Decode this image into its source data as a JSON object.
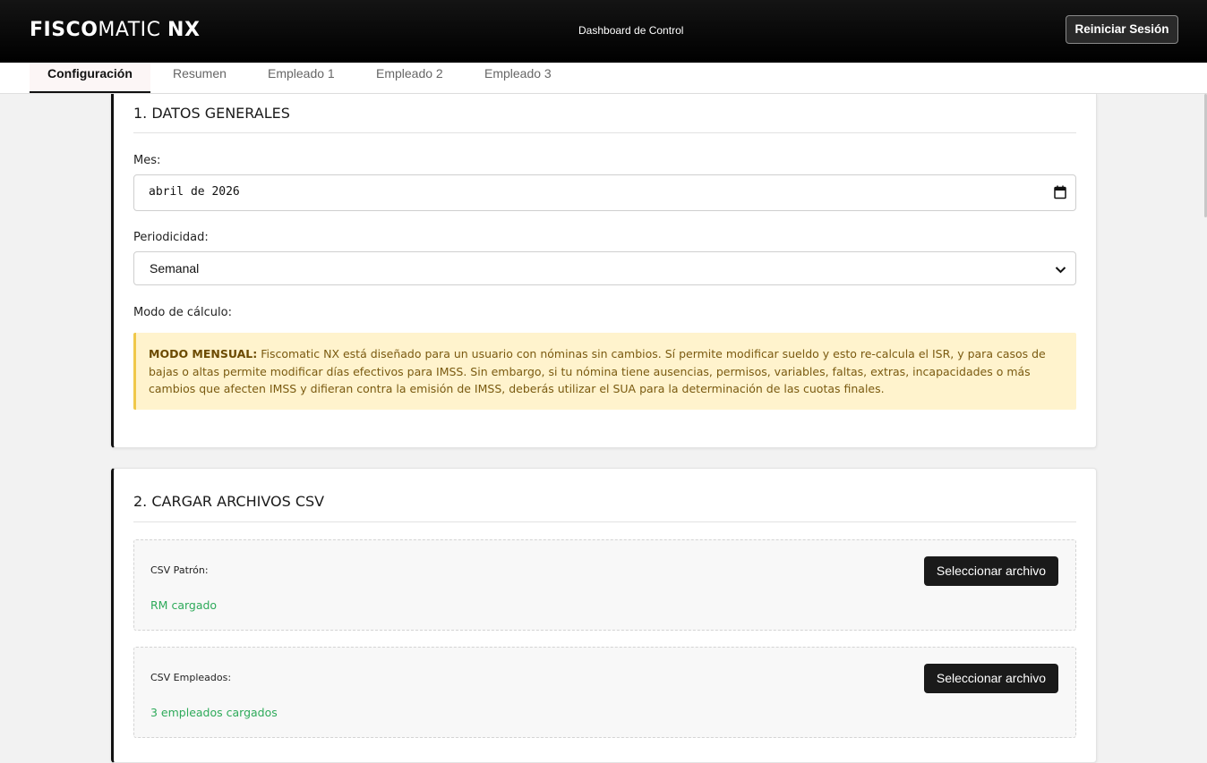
{
  "header": {
    "brand_part1": "FISCO",
    "brand_part2": "MATIC",
    "brand_part3": "NX",
    "center_title": "Dashboard de Control",
    "reset_label": "Reiniciar Sesión"
  },
  "tabs": [
    {
      "label": "Configuración",
      "active": true
    },
    {
      "label": "Resumen",
      "active": false
    },
    {
      "label": "Empleado 1",
      "active": false
    },
    {
      "label": "Empleado 2",
      "active": false
    },
    {
      "label": "Empleado 3",
      "active": false
    }
  ],
  "general": {
    "title": "1. DATOS GENERALES",
    "month_label": "Mes:",
    "month_value": "abril de 2026",
    "periodicity_label": "Periodicidad:",
    "periodicity_value": "Semanal",
    "mode_label": "Modo de cálculo:",
    "notice_strong": "MODO MENSUAL:",
    "notice_text": "Fiscomatic NX está diseñado para un usuario con nóminas sin cambios. Sí permite modificar sueldo y esto re-calcula el ISR, y para casos de bajas o altas permite modificar días efectivos para IMSS. Sin embargo, si tu nómina tiene ausencias, permisos, variables, faltas, extras, incapacidades o más cambios que afecten IMSS y difieran contra la emisión de IMSS, deberás utilizar el SUA para la determinación de las cuotas finales."
  },
  "csv": {
    "title": "2. CARGAR ARCHIVOS CSV",
    "patron_label": "CSV Patrón:",
    "patron_status": "RM cargado",
    "empleados_label": "CSV Empleados:",
    "empleados_status": "3 empleados cargados",
    "select_button": "Seleccionar archivo"
  },
  "colors": {
    "topbar": "#000000",
    "notice_bg": "#fff3cd",
    "notice_border": "#f0c84a",
    "success": "#2eaa5a",
    "button": "#1a1a1a"
  }
}
